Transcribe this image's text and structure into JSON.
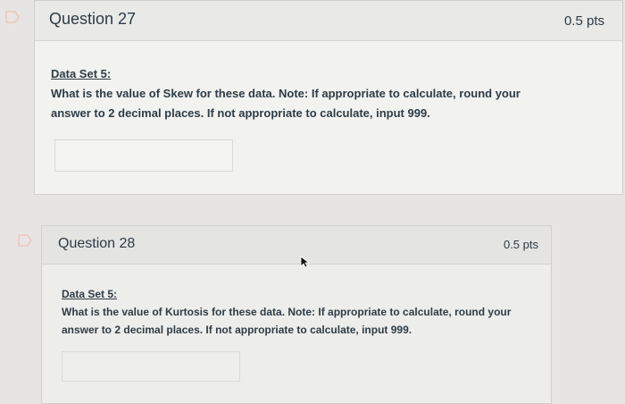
{
  "questions": [
    {
      "title": "Question 27",
      "points": "0.5 pts",
      "data_set": "Data Set 5:",
      "prompt": "What is the value of Skew for these data.  Note: If appropriate to calculate, round your answer to 2 decimal places.  If not appropriate to calculate, input 999.",
      "answer_value": ""
    },
    {
      "title": "Question 28",
      "points": "0.5 pts",
      "data_set": "Data Set 5:",
      "prompt": "What is the value of Kurtosis for these data.  Note: If appropriate to calculate, round your answer to 2 decimal places.  If not appropriate to calculate, input 999.",
      "answer_value": ""
    }
  ],
  "icons": {
    "flag": "bookmark-flag-icon",
    "cursor": "mouse-pointer-icon"
  },
  "colors": {
    "background": "#e6e5e3",
    "text": "#2d3b45",
    "border": "#cfcfcd"
  }
}
